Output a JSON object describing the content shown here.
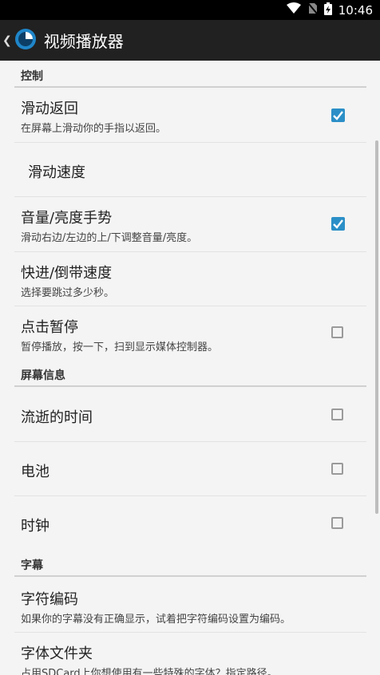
{
  "status": {
    "time": "10:46"
  },
  "app": {
    "title": "视频播放器"
  },
  "sections": {
    "control": "控制",
    "screen_info": "屏幕信息",
    "subtitle": "字幕"
  },
  "items": {
    "swipe_back": {
      "title": "滑动返回",
      "summary": "在屏幕上滑动你的手指以返回。",
      "checked": true
    },
    "swipe_speed": {
      "title": "滑动速度"
    },
    "volume_gesture": {
      "title": "音量/亮度手势",
      "summary": "滑动右边/左边的上/下调整音量/亮度。",
      "checked": true
    },
    "seek_speed": {
      "title": "快进/倒带速度",
      "summary": "选择要跳过多少秒。"
    },
    "tap_pause": {
      "title": "点击暂停",
      "summary": "暂停播放，按一下，扫到显示媒体控制器。",
      "checked": false
    },
    "elapsed_time": {
      "title": "流逝的时间",
      "checked": false
    },
    "battery": {
      "title": "电池",
      "checked": false
    },
    "clock": {
      "title": "时钟",
      "checked": false
    },
    "char_encoding": {
      "title": "字符编码",
      "summary": "如果你的字幕没有正确显示，试着把字符编码设置为编码。"
    },
    "font_folder": {
      "title": "字体文件夹",
      "summary": "占用SDCard上你想使用有一些特殊的字体？指定路径。"
    }
  },
  "colors": {
    "accent": "#2b8fc7",
    "appbar": "#212121"
  }
}
